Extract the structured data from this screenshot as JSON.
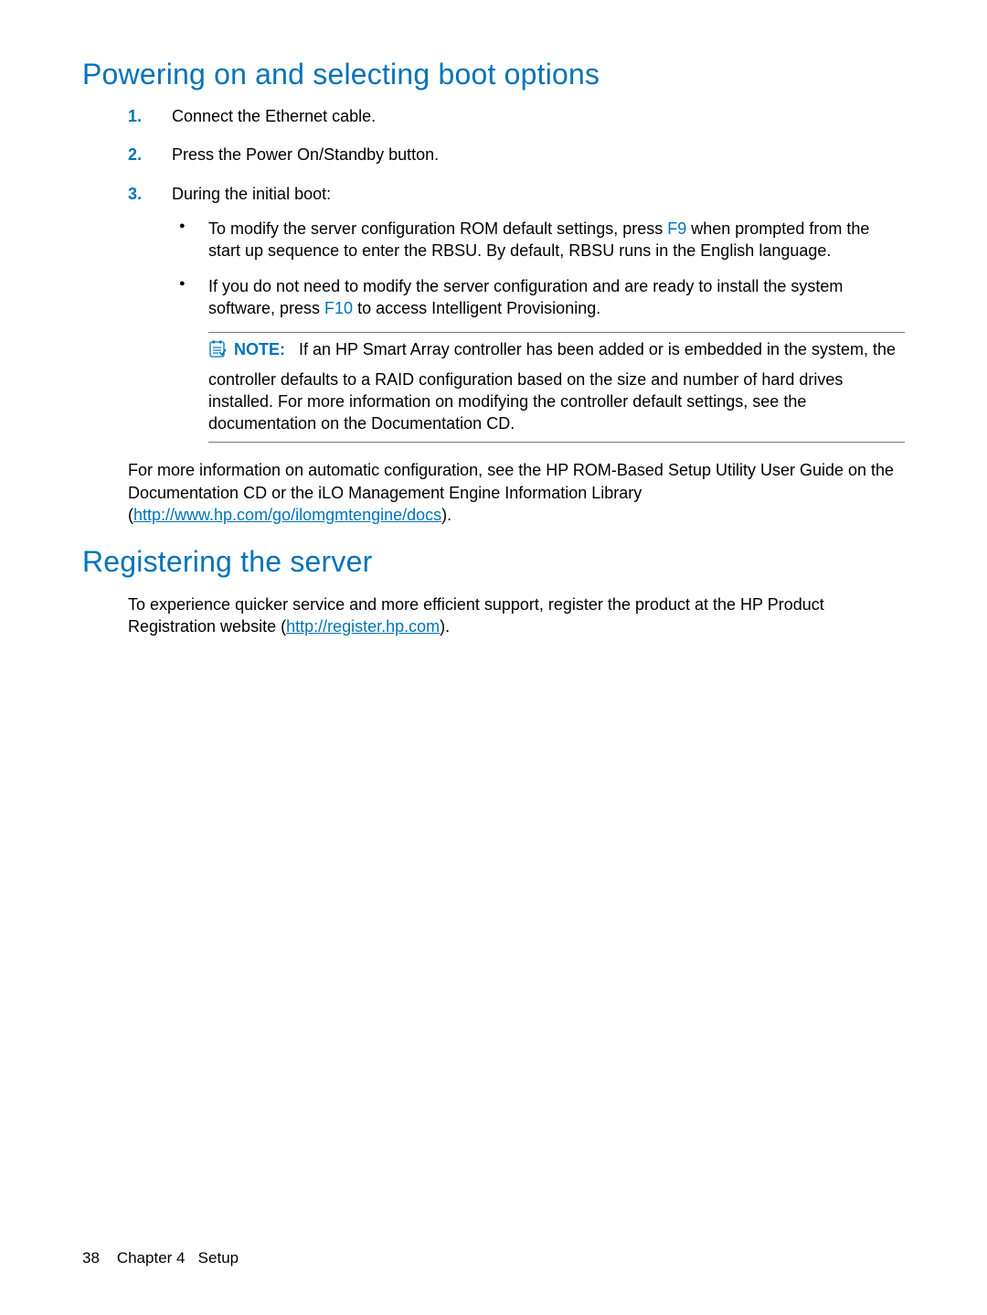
{
  "heading1": "Powering on and selecting boot options",
  "steps": {
    "s1_marker": "1.",
    "s1_text": "Connect the Ethernet cable.",
    "s2_marker": "2.",
    "s2_text": "Press the Power On/Standby button.",
    "s3_marker": "3.",
    "s3_text": "During the initial boot:"
  },
  "bullets": {
    "b1_pre": "To modify the server configuration ROM default settings, press ",
    "b1_key": "F9",
    "b1_post": " when prompted from the start up sequence to enter the RBSU. By default, RBSU runs in the English language.",
    "b2_pre": "If you do not need to modify the server configuration and are ready to install the system software, press ",
    "b2_key": "F10",
    "b2_post": " to access Intelligent Provisioning."
  },
  "note": {
    "label": "NOTE:",
    "first_line": "If an HP Smart Array controller has been added or is embedded in the system, the",
    "rest": "controller defaults to a RAID configuration based on the size and number of hard drives installed. For more information on modifying the controller default settings, see the documentation on the Documentation CD."
  },
  "after_note": {
    "pre": "For more information on automatic configuration, see the HP ROM-Based Setup Utility User Guide on the Documentation CD or the iLO Management Engine Information Library (",
    "link": "http://www.hp.com/go/ilomgmtengine/docs",
    "post": ")."
  },
  "heading2": "Registering the server",
  "register": {
    "pre": "To experience quicker service and more efficient support, register the product at the HP Product Registration website (",
    "link": "http://register.hp.com",
    "post": ")."
  },
  "footer": {
    "page_no": "38",
    "chapter_label": "Chapter 4",
    "chapter_title": "Setup"
  }
}
